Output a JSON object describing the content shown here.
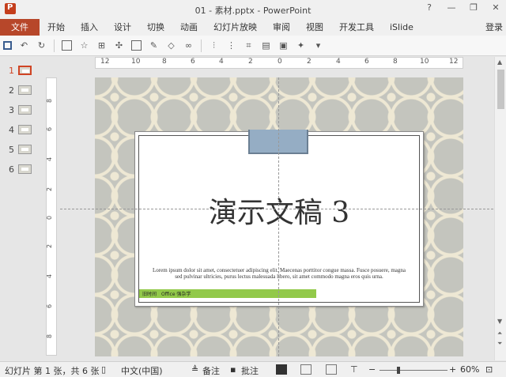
{
  "window": {
    "title": "01 - 素材.pptx - PowerPoint",
    "help": "?",
    "minimize": "—",
    "restore": "❐",
    "close": "✕"
  },
  "ribbon": {
    "tabs": [
      "文件",
      "开始",
      "插入",
      "设计",
      "切换",
      "动画",
      "幻灯片放映",
      "审阅",
      "视图",
      "开发工具",
      "iSlide"
    ],
    "login": "登录"
  },
  "ruler": {
    "h_ticks": [
      "12",
      "10",
      "8",
      "6",
      "4",
      "2",
      "0",
      "2",
      "4",
      "6",
      "8",
      "10",
      "12"
    ],
    "v_ticks": [
      "8",
      "6",
      "4",
      "2",
      "0",
      "2",
      "4",
      "6",
      "8"
    ]
  },
  "thumbnails": [
    {
      "num": "1",
      "active": true
    },
    {
      "num": "2",
      "active": false
    },
    {
      "num": "3",
      "active": false
    },
    {
      "num": "4",
      "active": false
    },
    {
      "num": "5",
      "active": false
    },
    {
      "num": "6",
      "active": false
    }
  ],
  "slide": {
    "title": "演示文稿 3",
    "body": "Lorem ipsum dolor sit amet, consectetuer adipiscing elit. Maecenas porttitor congue massa. Fusce posuere, magna sed pulvinar ultricies, purus lectus malesuada libero, sit amet commodo magna eros quis urna.",
    "footer_left": "旧时间",
    "footer_right": "Office 强杂学",
    "footer_color": "#92c94a",
    "accent_color": "#95adc4"
  },
  "status": {
    "slide_info": "幻灯片 第 1 张，共 6 张",
    "language": "中文(中国)",
    "notes": "备注",
    "comments": "批注",
    "zoom": "60%",
    "zoom_fraction": 0.6,
    "zoom_minus": "−",
    "zoom_plus": "+"
  }
}
